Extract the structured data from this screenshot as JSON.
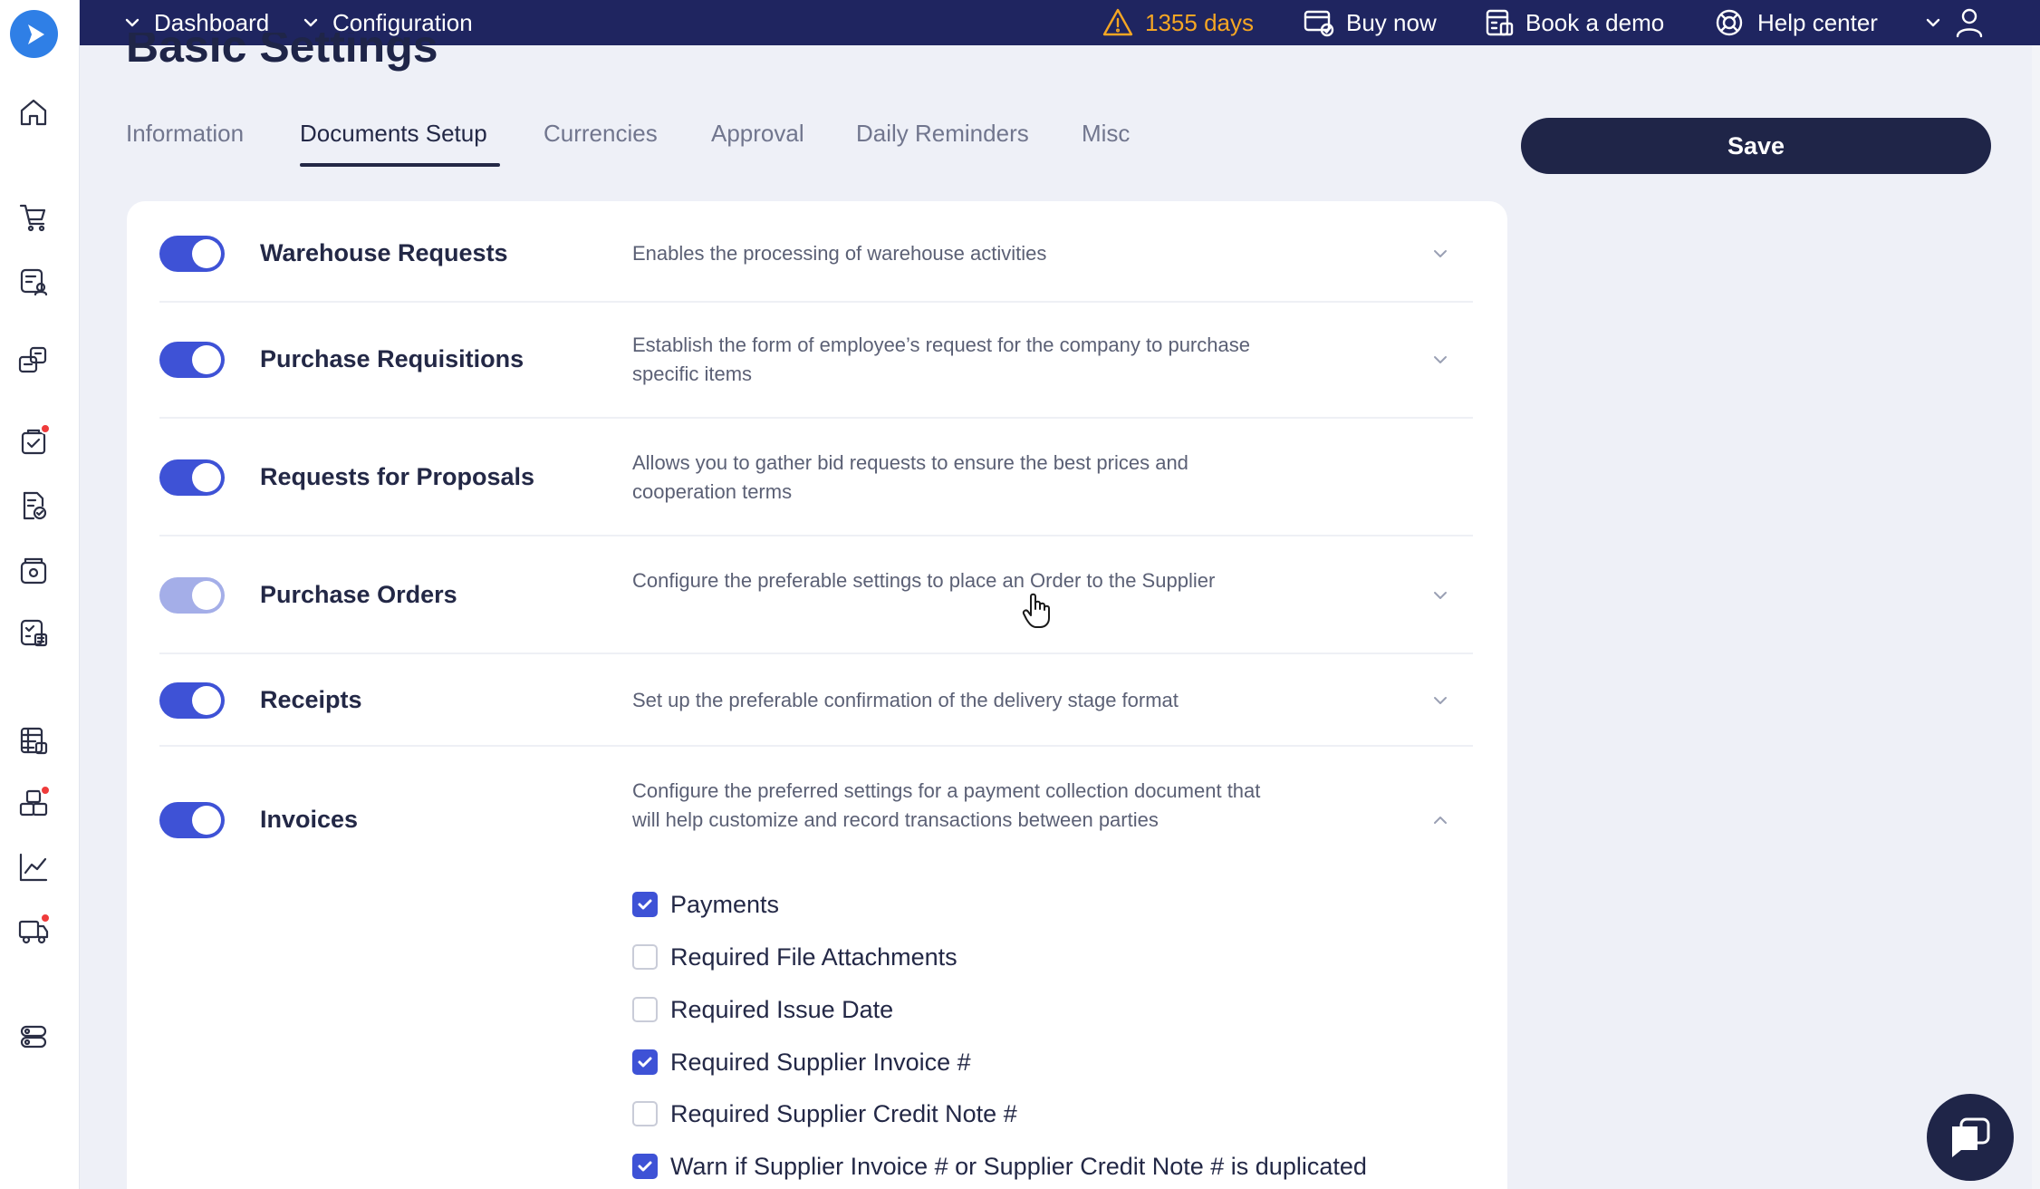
{
  "topbar": {
    "nav": [
      {
        "label": "Dashboard"
      },
      {
        "label": "Configuration"
      }
    ],
    "trial_warning": "1355 days",
    "buy_now": "Buy now",
    "book_demo": "Book a demo",
    "help_center": "Help center"
  },
  "page": {
    "title": "Basic Settings"
  },
  "tabs": [
    {
      "label": "Information"
    },
    {
      "label": "Documents Setup",
      "active": true
    },
    {
      "label": "Currencies"
    },
    {
      "label": "Approval"
    },
    {
      "label": "Daily Reminders"
    },
    {
      "label": "Misc"
    }
  ],
  "save_label": "Save",
  "modules": [
    {
      "title": "Warehouse Requests",
      "description": "Enables the processing of warehouse activities",
      "enabled": true,
      "expandable": true
    },
    {
      "title": "Purchase Requisitions",
      "description": "Establish the form of employee’s request for the company to purchase specific items",
      "enabled": true,
      "expandable": true
    },
    {
      "title": "Requests for Proposals",
      "description": "Allows you to gather bid requests to ensure the best prices and cooperation terms",
      "enabled": true,
      "expandable": false
    },
    {
      "title": "Purchase Orders",
      "description": "Configure the preferable settings to place an Order to the Supplier",
      "enabled": true,
      "expandable": true
    },
    {
      "title": "Receipts",
      "description": "Set up the preferable confirmation of the delivery stage format",
      "enabled": true,
      "expandable": true
    },
    {
      "title": "Invoices",
      "description": "Configure the preferred settings for a payment collection document that will help customize and record transactions between parties",
      "enabled": true,
      "expanded": true
    }
  ],
  "invoice_options": [
    {
      "label": "Payments",
      "checked": true
    },
    {
      "label": "Required File Attachments",
      "checked": false
    },
    {
      "label": "Required Issue Date",
      "checked": false
    },
    {
      "label": "Required Supplier Invoice #",
      "checked": true
    },
    {
      "label": "Required Supplier Credit Note #",
      "checked": false
    },
    {
      "label": "Warn if Supplier Invoice # or Supplier Credit Note # is duplicated",
      "checked": true
    }
  ],
  "colors": {
    "topbar": "#1f2560",
    "accent": "#3e52d6",
    "warning": "#f5a623",
    "badge": "#ef3b3b"
  },
  "sidebar_icons": [
    "home-icon",
    "cart-icon",
    "requests-icon",
    "rfp-icon",
    "orders-icon",
    "receipt-icon",
    "wallet-icon",
    "invoice-icon",
    "ledger-icon",
    "inventory-icon",
    "analytics-icon",
    "delivery-icon",
    "settings-icon"
  ]
}
